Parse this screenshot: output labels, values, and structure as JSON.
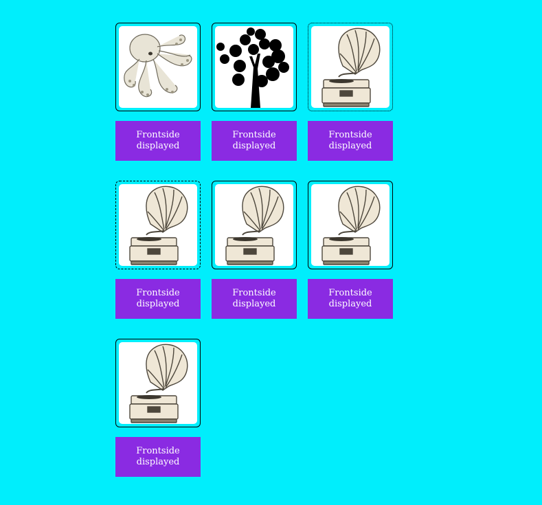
{
  "colors": {
    "background": "#00eefc",
    "button": "#8a2be2",
    "button_text": "#ffffff"
  },
  "cards": [
    {
      "icon": "octopus-icon",
      "border": "solid",
      "button_label": "Frontside displayed"
    },
    {
      "icon": "tree-icon",
      "border": "solid",
      "button_label": "Frontside displayed"
    },
    {
      "icon": "gramophone-icon",
      "border": "dotted",
      "button_label": "Frontside displayed"
    },
    {
      "icon": "gramophone-icon",
      "border": "dashed",
      "button_label": "Frontside displayed"
    },
    {
      "icon": "gramophone-icon",
      "border": "solid",
      "button_label": "Frontside displayed"
    },
    {
      "icon": "gramophone-icon",
      "border": "solid",
      "button_label": "Frontside displayed"
    },
    {
      "icon": "gramophone-icon",
      "border": "solid",
      "button_label": "Frontside displayed"
    }
  ]
}
